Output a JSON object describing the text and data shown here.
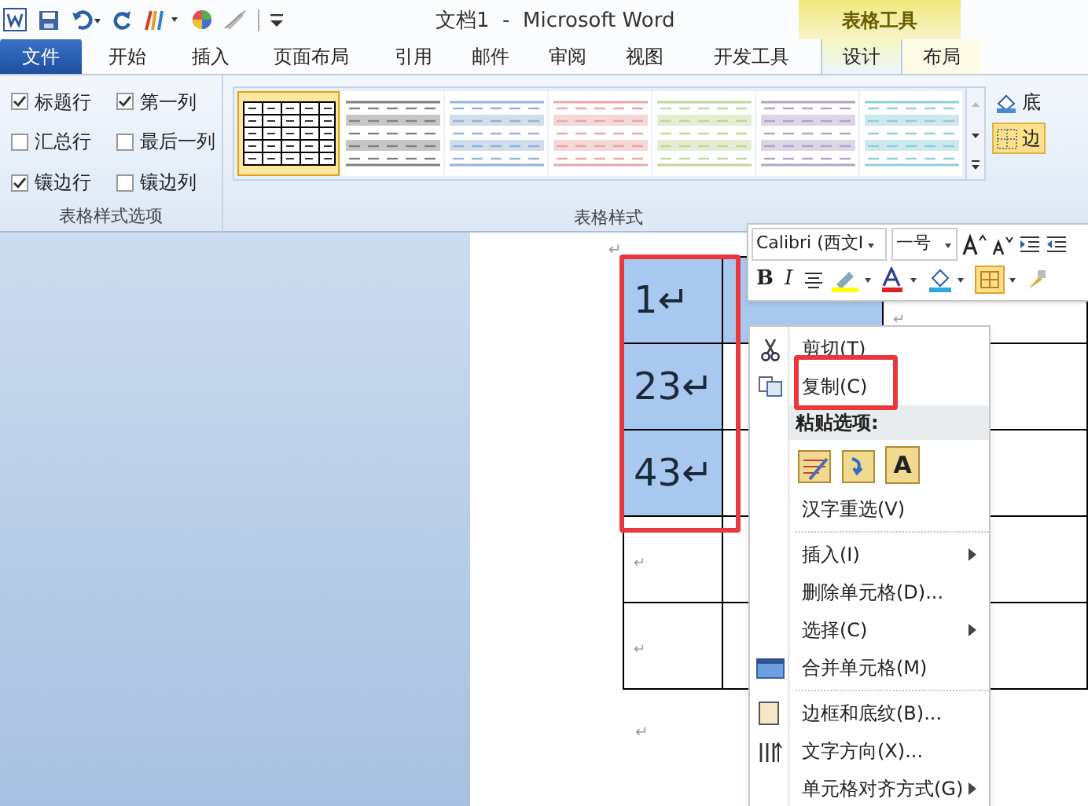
{
  "title_bar": {
    "title": "文档1  -  Microsoft Word",
    "context_group": "表格工具"
  },
  "tabs": [
    {
      "label": "文件",
      "kind": "file",
      "selected": false
    },
    {
      "label": "开始",
      "kind": "tab",
      "selected": false
    },
    {
      "label": "插入",
      "kind": "tab",
      "selected": false
    },
    {
      "label": "页面布局",
      "kind": "tab",
      "selected": false
    },
    {
      "label": "引用",
      "kind": "tab",
      "selected": false
    },
    {
      "label": "邮件",
      "kind": "tab",
      "selected": false
    },
    {
      "label": "审阅",
      "kind": "tab",
      "selected": false
    },
    {
      "label": "视图",
      "kind": "tab",
      "selected": false
    },
    {
      "label": "开发工具",
      "kind": "tab",
      "selected": false
    },
    {
      "label": "设计",
      "kind": "context",
      "selected": true
    },
    {
      "label": "布局",
      "kind": "context",
      "selected": false
    }
  ],
  "style_options": {
    "label": "表格样式选项",
    "checkboxes": [
      {
        "label": "标题行",
        "checked": true
      },
      {
        "label": "汇总行",
        "checked": false
      },
      {
        "label": "镶边行",
        "checked": true
      },
      {
        "label": "第一列",
        "checked": true
      },
      {
        "label": "最后一列",
        "checked": false
      },
      {
        "label": "镶边列",
        "checked": false
      }
    ]
  },
  "table_styles": {
    "label": "表格样式",
    "styles": [
      {
        "kind": "grid",
        "color": "#000000",
        "selected": true
      },
      {
        "kind": "banded",
        "color": "#808080",
        "selected": false
      },
      {
        "kind": "banded",
        "color": "#95b3d7",
        "selected": false
      },
      {
        "kind": "banded",
        "color": "#e6a8a7",
        "selected": false
      },
      {
        "kind": "banded",
        "color": "#c3d69b",
        "selected": false
      },
      {
        "kind": "banded",
        "color": "#b2a2c7",
        "selected": false
      },
      {
        "kind": "banded",
        "color": "#92cddc",
        "selected": false
      }
    ]
  },
  "side_buttons": [
    {
      "label": "底",
      "selected": false
    },
    {
      "label": "边",
      "selected": true
    }
  ],
  "mini_toolbar": {
    "font": "Calibri (西文I",
    "size": "一号",
    "bold": "B",
    "italic": "I"
  },
  "document": {
    "top_mark": "↵",
    "bottom_mark": "↵",
    "table": {
      "rows": [
        {
          "cells": [
            {
              "text": "1↵",
              "selected": true
            },
            {
              "text": "",
              "selected": true
            },
            {
              "text": "↵",
              "selected": false
            }
          ]
        },
        {
          "cells": [
            {
              "text": "23↵",
              "selected": true
            },
            {
              "text": "",
              "selected": false
            },
            {
              "text": "",
              "selected": false
            }
          ]
        },
        {
          "cells": [
            {
              "text": "43↵",
              "selected": true
            },
            {
              "text": "",
              "selected": false
            },
            {
              "text": "",
              "selected": false
            }
          ]
        },
        {
          "cells": [
            {
              "text": "↵",
              "selected": false
            },
            {
              "text": "",
              "selected": false
            },
            {
              "text": "",
              "selected": false
            }
          ]
        },
        {
          "cells": [
            {
              "text": "↵",
              "selected": false
            },
            {
              "text": "",
              "selected": false
            },
            {
              "text": "",
              "selected": false
            }
          ]
        }
      ]
    }
  },
  "context_menu": [
    {
      "kind": "item",
      "label": "剪切(T)",
      "submenu": false
    },
    {
      "kind": "item",
      "label": "复制(C)",
      "submenu": false
    },
    {
      "kind": "header",
      "label": "粘贴选项:"
    },
    {
      "kind": "paste",
      "label": "A"
    },
    {
      "kind": "item",
      "label": "汉字重选(V)",
      "submenu": false
    },
    {
      "kind": "separator"
    },
    {
      "kind": "item",
      "label": "插入(I)",
      "submenu": true
    },
    {
      "kind": "item",
      "label": "删除单元格(D)...",
      "submenu": false
    },
    {
      "kind": "item",
      "label": "选择(C)",
      "submenu": true
    },
    {
      "kind": "item",
      "label": "合并单元格(M)",
      "submenu": false
    },
    {
      "kind": "separator"
    },
    {
      "kind": "item",
      "label": "边框和底纹(B)...",
      "submenu": false
    },
    {
      "kind": "item",
      "label": "文字方向(X)...",
      "submenu": false
    },
    {
      "kind": "item",
      "label": "单元格对齐方式(G)",
      "submenu": true
    }
  ]
}
